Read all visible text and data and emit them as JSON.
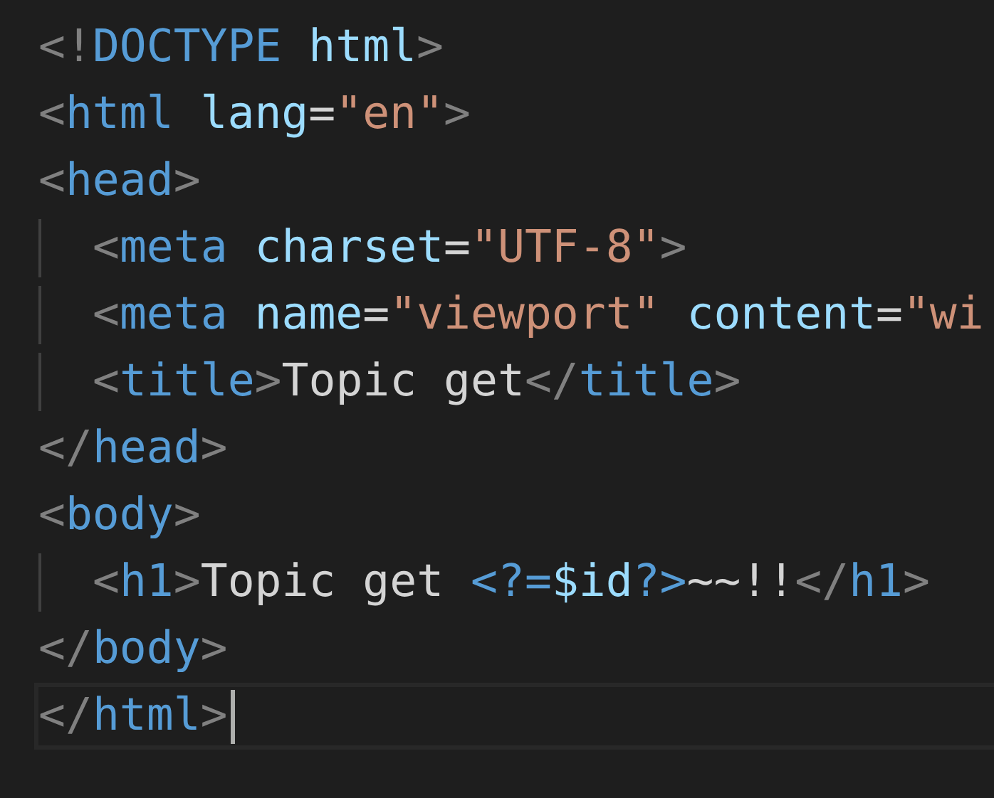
{
  "editor": {
    "lines": [
      {
        "indented": false,
        "current": false,
        "tokens": [
          {
            "kind": "punct",
            "text": "<!"
          },
          {
            "kind": "tag",
            "text": "DOCTYPE"
          },
          {
            "kind": "attr",
            "text": " html"
          },
          {
            "kind": "punct",
            "text": ">"
          }
        ]
      },
      {
        "indented": false,
        "current": false,
        "tokens": [
          {
            "kind": "punct",
            "text": "<"
          },
          {
            "kind": "tag",
            "text": "html"
          },
          {
            "kind": "attr",
            "text": " lang"
          },
          {
            "kind": "text",
            "text": "="
          },
          {
            "kind": "string",
            "text": "\"en\""
          },
          {
            "kind": "punct",
            "text": ">"
          }
        ]
      },
      {
        "indented": false,
        "current": false,
        "tokens": [
          {
            "kind": "punct",
            "text": "<"
          },
          {
            "kind": "tag",
            "text": "head"
          },
          {
            "kind": "punct",
            "text": ">"
          }
        ]
      },
      {
        "indented": true,
        "current": false,
        "tokens": [
          {
            "kind": "punct",
            "text": "<"
          },
          {
            "kind": "tag",
            "text": "meta"
          },
          {
            "kind": "attr",
            "text": " charset"
          },
          {
            "kind": "text",
            "text": "="
          },
          {
            "kind": "string",
            "text": "\"UTF-8\""
          },
          {
            "kind": "punct",
            "text": ">"
          }
        ]
      },
      {
        "indented": true,
        "current": false,
        "tokens": [
          {
            "kind": "punct",
            "text": "<"
          },
          {
            "kind": "tag",
            "text": "meta"
          },
          {
            "kind": "attr",
            "text": " name"
          },
          {
            "kind": "text",
            "text": "="
          },
          {
            "kind": "string",
            "text": "\"viewport\""
          },
          {
            "kind": "attr",
            "text": " content"
          },
          {
            "kind": "text",
            "text": "="
          },
          {
            "kind": "string",
            "text": "\"wi"
          }
        ]
      },
      {
        "indented": true,
        "current": false,
        "tokens": [
          {
            "kind": "punct",
            "text": "<"
          },
          {
            "kind": "tag",
            "text": "title"
          },
          {
            "kind": "punct",
            "text": ">"
          },
          {
            "kind": "text",
            "text": "Topic get"
          },
          {
            "kind": "punct",
            "text": "</"
          },
          {
            "kind": "tag",
            "text": "title"
          },
          {
            "kind": "punct",
            "text": ">"
          }
        ]
      },
      {
        "indented": false,
        "current": false,
        "tokens": [
          {
            "kind": "punct",
            "text": "</"
          },
          {
            "kind": "tag",
            "text": "head"
          },
          {
            "kind": "punct",
            "text": ">"
          }
        ]
      },
      {
        "indented": false,
        "current": false,
        "tokens": [
          {
            "kind": "punct",
            "text": "<"
          },
          {
            "kind": "tag",
            "text": "body"
          },
          {
            "kind": "punct",
            "text": ">"
          }
        ]
      },
      {
        "indented": true,
        "current": false,
        "tokens": [
          {
            "kind": "punct",
            "text": "<"
          },
          {
            "kind": "tag",
            "text": "h1"
          },
          {
            "kind": "punct",
            "text": ">"
          },
          {
            "kind": "text",
            "text": "Topic get "
          },
          {
            "kind": "tag",
            "text": "<?="
          },
          {
            "kind": "attr",
            "text": "$id"
          },
          {
            "kind": "tag",
            "text": "?>"
          },
          {
            "kind": "text",
            "text": "~~!!"
          },
          {
            "kind": "punct",
            "text": "</"
          },
          {
            "kind": "tag",
            "text": "h1"
          },
          {
            "kind": "punct",
            "text": ">"
          }
        ]
      },
      {
        "indented": false,
        "current": false,
        "tokens": [
          {
            "kind": "punct",
            "text": "</"
          },
          {
            "kind": "tag",
            "text": "body"
          },
          {
            "kind": "punct",
            "text": ">"
          }
        ]
      },
      {
        "indented": false,
        "current": true,
        "tokens": [
          {
            "kind": "punct",
            "text": "</"
          },
          {
            "kind": "tag",
            "text": "html"
          },
          {
            "kind": "punct",
            "text": ">"
          }
        ]
      }
    ]
  }
}
